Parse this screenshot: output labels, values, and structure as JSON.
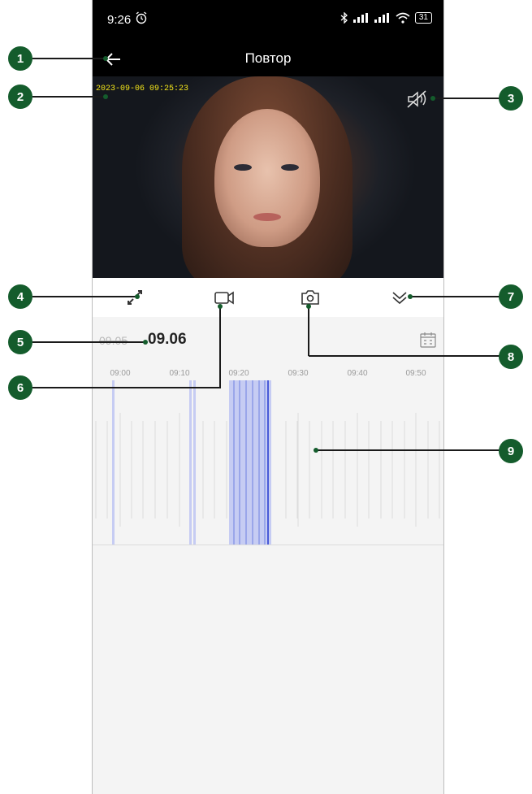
{
  "status_bar": {
    "time": "9:26",
    "alarm_icon": "alarm-icon",
    "battery": "31"
  },
  "app_bar": {
    "title": "Повтор",
    "back_icon": "arrow-left-icon"
  },
  "video": {
    "timestamp": "2023-09-06 09:25:23",
    "mute_icon": "speaker-mute-icon"
  },
  "toolbar": {
    "items": [
      {
        "name": "fullscreen",
        "icon": "expand-icon"
      },
      {
        "name": "record",
        "icon": "video-camera-icon"
      },
      {
        "name": "snapshot",
        "icon": "camera-icon"
      },
      {
        "name": "collapse",
        "icon": "chevron-double-down-icon"
      }
    ]
  },
  "dates": {
    "previous": "09.05",
    "current": "09.06",
    "calendar_icon": "calendar-icon"
  },
  "timeline": {
    "ticks": [
      "09:00",
      "09:10",
      "09:20",
      "09:30",
      "09:40",
      "09:50"
    ],
    "playhead_time": "09:25"
  },
  "callouts": [
    "1",
    "2",
    "3",
    "4",
    "5",
    "6",
    "7",
    "8",
    "9"
  ],
  "colors": {
    "callout_bg": "#145c2c",
    "timestamp": "#f3e51a",
    "recording": "#6f7de0"
  }
}
